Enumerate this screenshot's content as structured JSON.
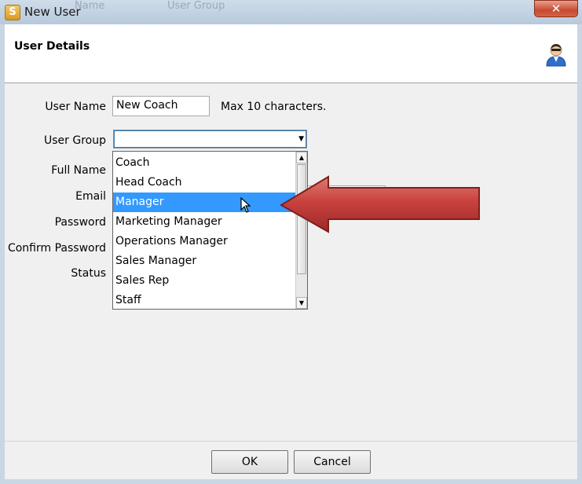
{
  "window": {
    "title": "New User",
    "close_glyph": "✕",
    "background_columns": [
      "Name",
      "User Group"
    ]
  },
  "header": {
    "title": "User Details",
    "icon": "user-icon"
  },
  "form": {
    "user_name": {
      "label": "User Name",
      "value": "New Coach",
      "hint": "Max 10 characters."
    },
    "user_group": {
      "label": "User Group",
      "value": ""
    },
    "full_name": {
      "label": "Full Name"
    },
    "email": {
      "label": "Email"
    },
    "password": {
      "label": "Password"
    },
    "confirm_password": {
      "label": "Confirm Password"
    },
    "status": {
      "label": "Status"
    }
  },
  "dropdown": {
    "options": [
      "Coach",
      "Head Coach",
      "Manager",
      "Marketing Manager",
      "Operations Manager",
      "Sales Manager",
      "Sales Rep",
      "Staff"
    ],
    "selected": "Manager"
  },
  "buttons": {
    "ok": "OK",
    "cancel": "Cancel"
  },
  "colors": {
    "selection": "#3399ff",
    "arrow": "#c9413f",
    "close": "#c84a30"
  }
}
